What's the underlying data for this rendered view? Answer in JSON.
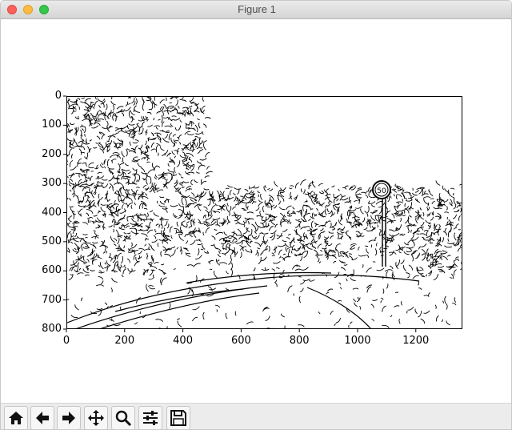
{
  "window": {
    "title": "Figure 1",
    "traffic_lights": [
      "close",
      "minimize",
      "zoom"
    ]
  },
  "chart_data": {
    "type": "image",
    "title": "",
    "xlabel": "",
    "ylabel": "",
    "xlim": [
      0,
      1360
    ],
    "ylim": [
      800,
      0
    ],
    "xticks": [
      "0",
      "200",
      "400",
      "600",
      "800",
      "1000",
      "1200"
    ],
    "yticks": [
      "0",
      "100",
      "200",
      "300",
      "400",
      "500",
      "600",
      "700",
      "800"
    ],
    "image_description_hidden": false,
    "content": "binary edge-detection image of a road with trees and a speed limit sign",
    "sign_text": "50"
  },
  "toolbar": {
    "buttons": [
      {
        "name": "home-icon",
        "label": "Home"
      },
      {
        "name": "back-icon",
        "label": "Back"
      },
      {
        "name": "forward-icon",
        "label": "Forward"
      },
      {
        "name": "pan-icon",
        "label": "Pan"
      },
      {
        "name": "zoom-icon",
        "label": "Zoom"
      },
      {
        "name": "subplots-icon",
        "label": "Configure subplots"
      },
      {
        "name": "save-icon",
        "label": "Save"
      }
    ]
  }
}
